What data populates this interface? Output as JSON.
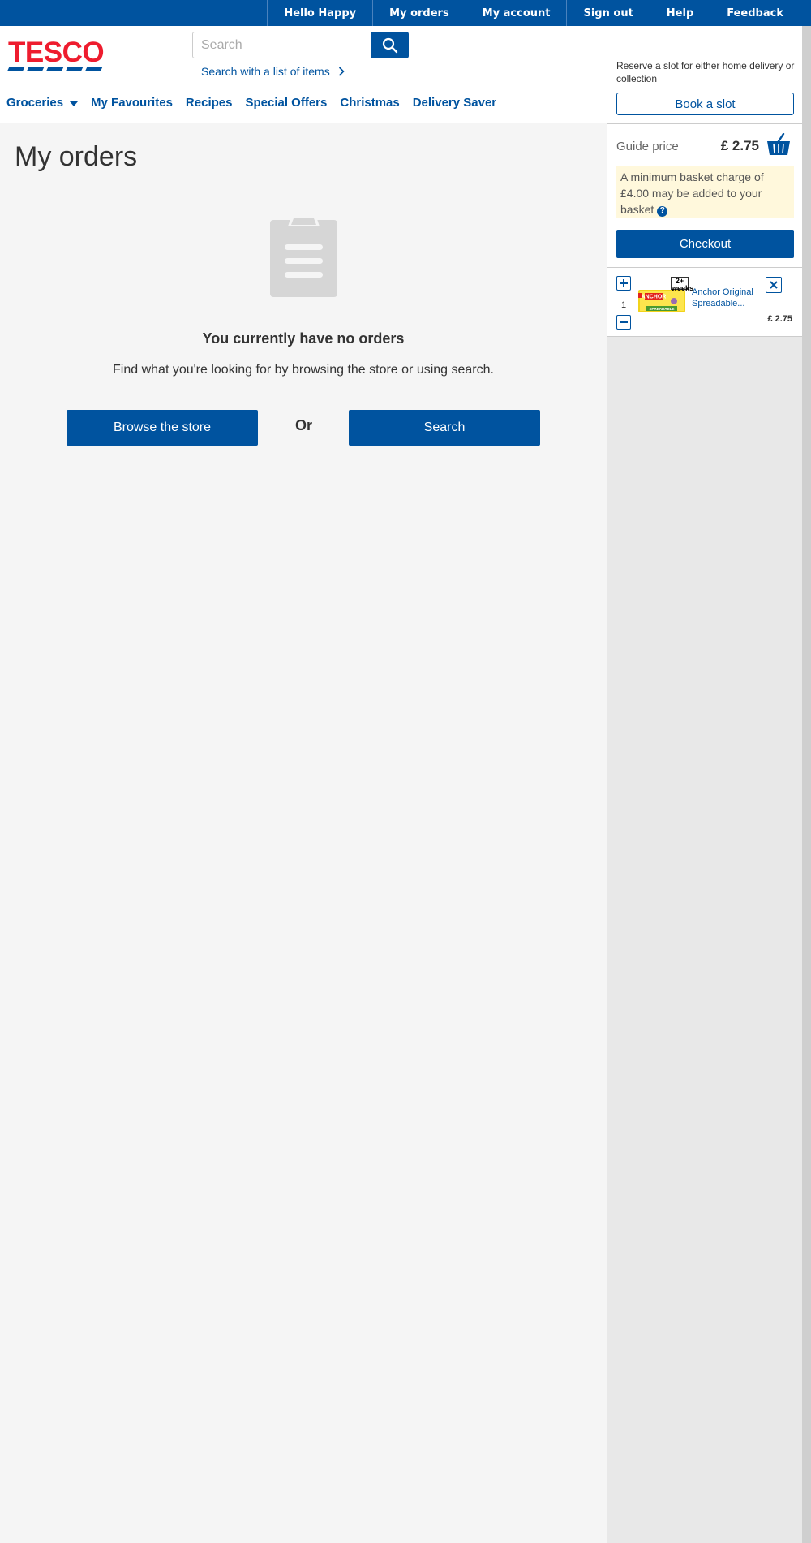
{
  "topbar": {
    "items": [
      "Hello Happy",
      "My orders",
      "My account",
      "Sign out",
      "Help",
      "Feedback"
    ]
  },
  "header": {
    "logo_text": "TESCO",
    "search": {
      "placeholder": "Search",
      "value": ""
    },
    "search_list_link": "Search with a list of items",
    "nav": [
      "Groceries",
      "My Favourites",
      "Recipes",
      "Special Offers",
      "Christmas",
      "Delivery Saver"
    ]
  },
  "main": {
    "title": "My orders",
    "empty_title": "You currently have no orders",
    "empty_subtitle": "Find what you're looking for by browsing the store or using search.",
    "browse_button": "Browse the store",
    "or_label": "Or",
    "search_button": "Search"
  },
  "sidebar": {
    "slot_text": "Reserve a slot for either home delivery or collection",
    "book_slot": "Book a slot",
    "guide_label": "Guide price",
    "guide_price": "£ 2.75",
    "notice": "A minimum basket charge of £4.00 may be added to your basket",
    "help_glyph": "?",
    "checkout": "Checkout",
    "basket_items": [
      {
        "name": "Anchor Original Spreadable...",
        "quantity": "1",
        "price": "£ 2.75",
        "badge": "2+ weeks",
        "brand": "ANCHOR",
        "subtitle": "SPREADABLE"
      }
    ]
  },
  "colors": {
    "brand_blue": "#00539f",
    "brand_red": "#ee1c2e",
    "notice_bg": "#fff8dc"
  }
}
